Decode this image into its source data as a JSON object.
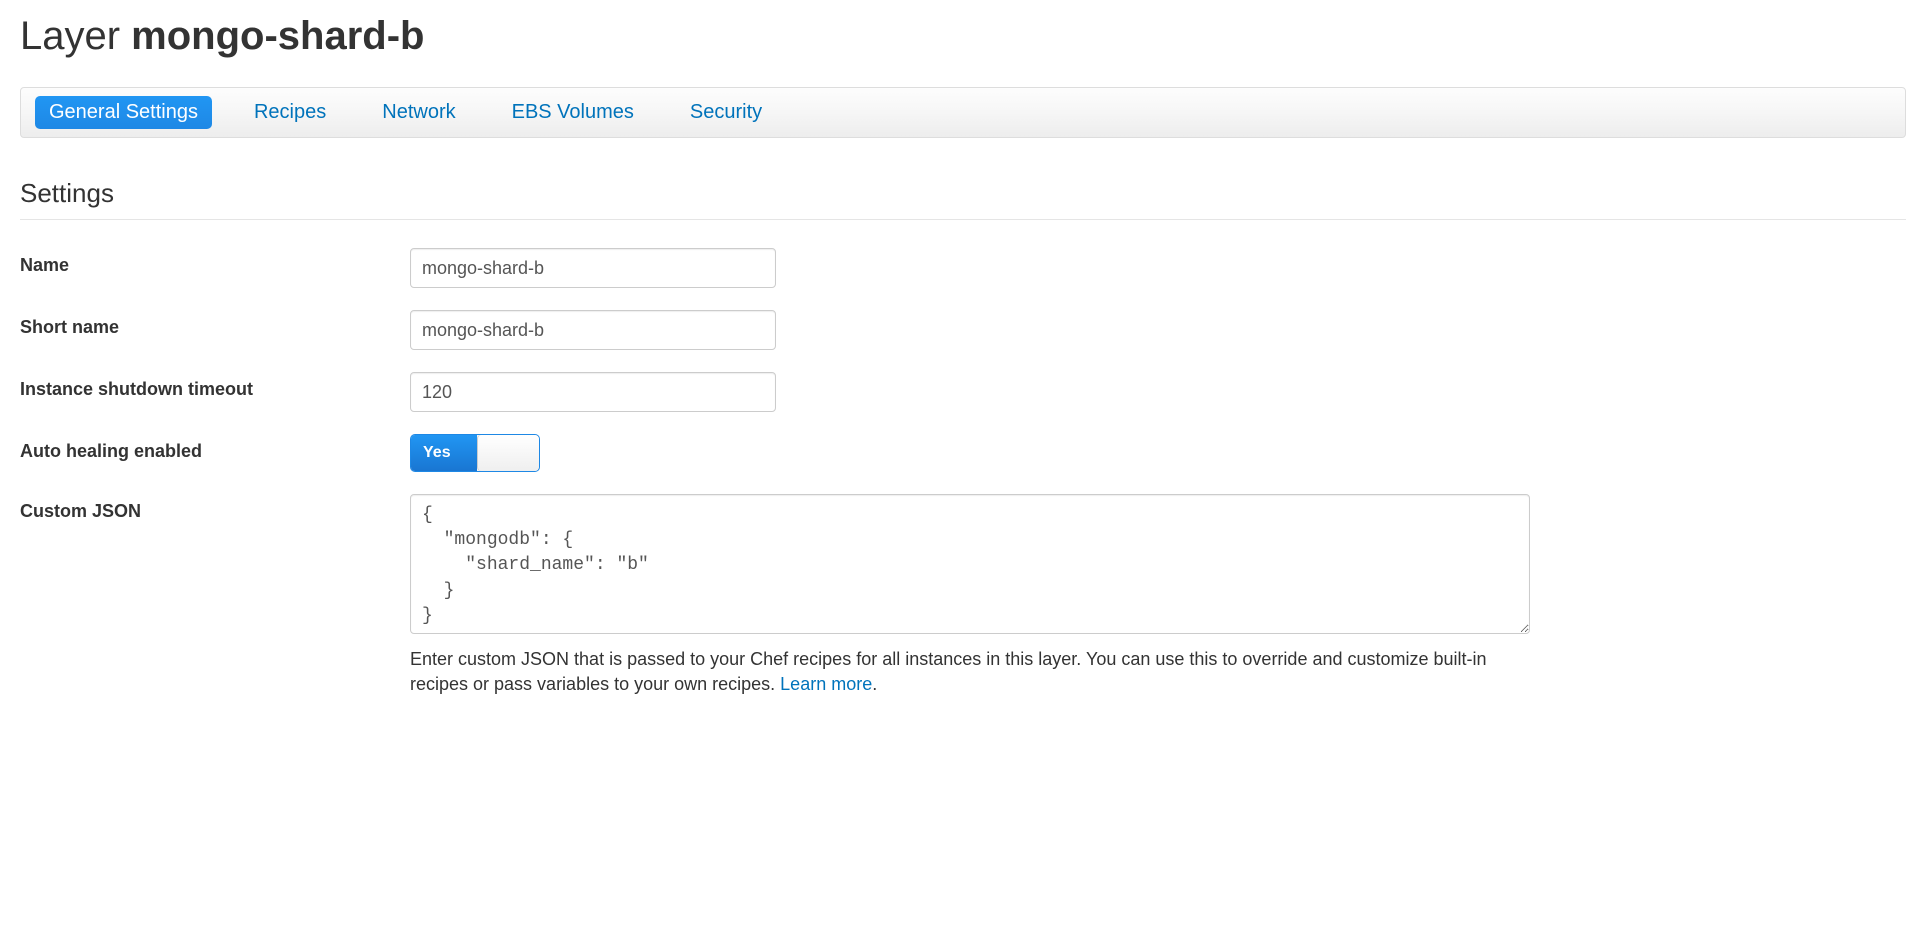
{
  "header": {
    "title_prefix": "Layer ",
    "title_name": "mongo-shard-b"
  },
  "tabs": [
    {
      "label": "General Settings",
      "active": true
    },
    {
      "label": "Recipes",
      "active": false
    },
    {
      "label": "Network",
      "active": false
    },
    {
      "label": "EBS Volumes",
      "active": false
    },
    {
      "label": "Security",
      "active": false
    }
  ],
  "section": {
    "title": "Settings"
  },
  "form": {
    "name_label": "Name",
    "name_value": "mongo-shard-b",
    "shortname_label": "Short name",
    "shortname_value": "mongo-shard-b",
    "timeout_label": "Instance shutdown timeout",
    "timeout_value": "120",
    "autoheal_label": "Auto healing enabled",
    "autoheal_value": "Yes",
    "customjson_label": "Custom JSON",
    "customjson_value": "{\n  \"mongodb\": {\n    \"shard_name\": \"b\"\n  }\n}",
    "customjson_help": "Enter custom JSON that is passed to your Chef recipes for all instances in this layer. You can use this to override and customize built-in recipes or pass variables to your own recipes. ",
    "customjson_learnmore": "Learn more"
  }
}
